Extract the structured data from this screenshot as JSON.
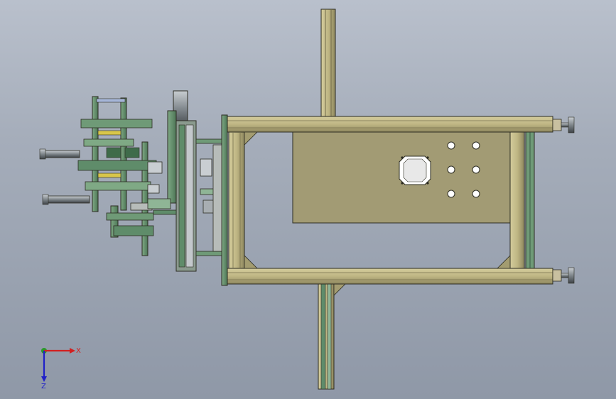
{
  "viewport": {
    "background_top": "#b9c0cc",
    "background_bottom": "#8f98a7"
  },
  "colors": {
    "frame_beam": "#c2b98a",
    "frame_beam_dark": "#8e875e",
    "base_plate": "#9e9872",
    "column": "#b8ae7a",
    "fixture_green": "#5f8c6a",
    "fixture_dark": "#2f4a38",
    "cylinder": "#8a8f93",
    "edge": "#2c2c22"
  },
  "triad": {
    "x_label": "X",
    "z_label": "Z",
    "x_color": "#d22020",
    "y_color": "#20a020",
    "z_color": "#2020c8"
  }
}
